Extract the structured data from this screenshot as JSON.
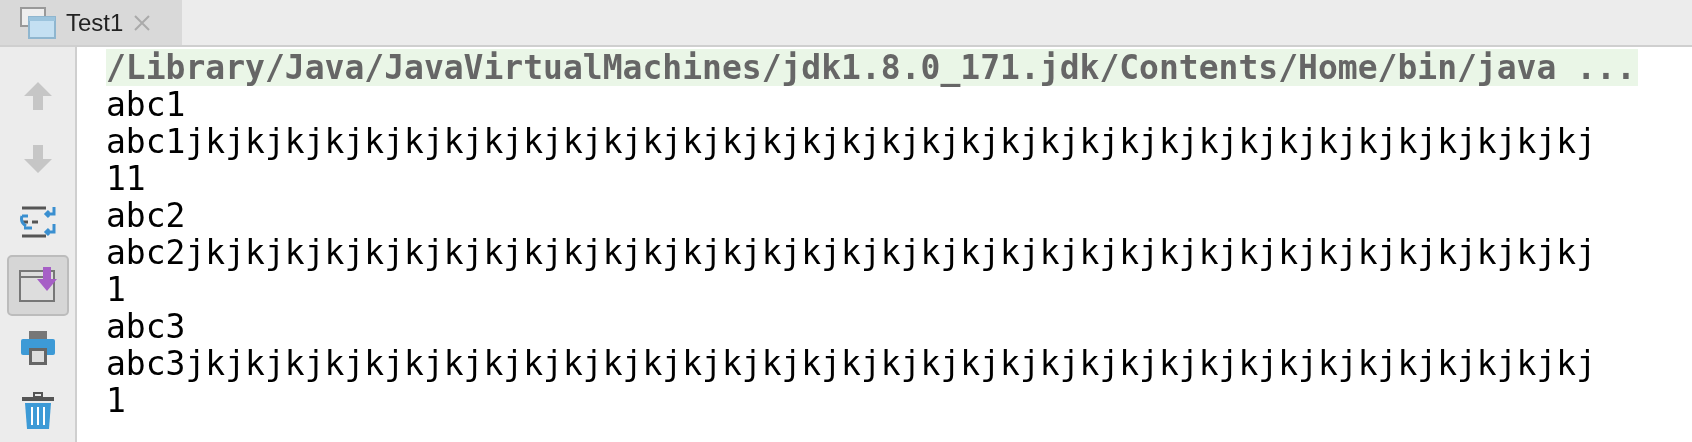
{
  "tabs": [
    {
      "label": "Test1",
      "selected": true
    }
  ],
  "toolbar": [
    {
      "kind": "up",
      "disabled": true,
      "selected": false
    },
    {
      "kind": "down",
      "disabled": true,
      "selected": false
    },
    {
      "kind": "wrap",
      "disabled": false,
      "selected": false
    },
    {
      "kind": "scroll-end",
      "disabled": false,
      "selected": true
    },
    {
      "kind": "print",
      "disabled": false,
      "selected": false
    },
    {
      "kind": "trash",
      "disabled": false,
      "selected": false
    }
  ],
  "console": {
    "lines": [
      {
        "kind": "command",
        "text": "/Library/Java/JavaVirtualMachines/jdk1.8.0_171.jdk/Contents/Home/bin/java ..."
      },
      {
        "kind": "output",
        "text": "abc1"
      },
      {
        "kind": "output",
        "text": "abc1jkjkjkjkjkjkjkjkjkjkjkjkjkjkjkjkjkjkjkjkjkjkjkjkjkjkjkjkjkjkjkjkjkjkjkj"
      },
      {
        "kind": "output",
        "text": "11"
      },
      {
        "kind": "output",
        "text": "abc2"
      },
      {
        "kind": "output",
        "text": "abc2jkjkjkjkjkjkjkjkjkjkjkjkjkjkjkjkjkjkjkjkjkjkjkjkjkjkjkjkjkjkjkjkjkjkjkj"
      },
      {
        "kind": "output",
        "text": "1"
      },
      {
        "kind": "output",
        "text": "abc3"
      },
      {
        "kind": "output",
        "text": "abc3jkjkjkjkjkjkjkjkjkjkjkjkjkjkjkjkjkjkjkjkjkjkjkjkjkjkjkjkjkjkjkjkjkjkjkj"
      },
      {
        "kind": "output",
        "text": "1"
      }
    ]
  }
}
